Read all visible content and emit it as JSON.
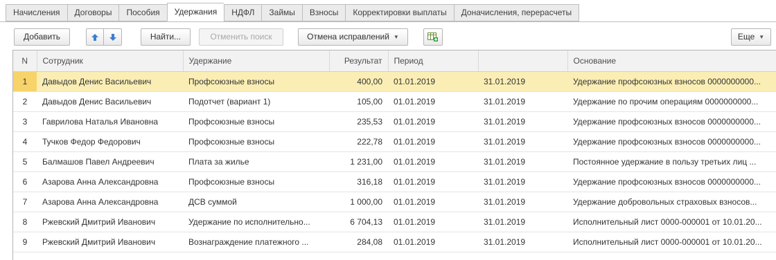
{
  "tabs": [
    {
      "label": "Начисления",
      "active": false
    },
    {
      "label": "Договоры",
      "active": false
    },
    {
      "label": "Пособия",
      "active": false
    },
    {
      "label": "Удержания",
      "active": true
    },
    {
      "label": "НДФЛ",
      "active": false
    },
    {
      "label": "Займы",
      "active": false
    },
    {
      "label": "Взносы",
      "active": false
    },
    {
      "label": "Корректировки выплаты",
      "active": false
    },
    {
      "label": "Доначисления, перерасчеты",
      "active": false
    }
  ],
  "toolbar": {
    "add_label": "Добавить",
    "find_label": "Найти...",
    "cancel_search_label": "Отменить поиск",
    "cancel_corrections_label": "Отмена исправлений",
    "more_label": "Еще",
    "up_icon": "arrow-up-icon",
    "down_icon": "arrow-down-icon",
    "grid_icon": "add-table-icon"
  },
  "colors": {
    "selected_row": "#fbeeb5",
    "selected_index": "#f7d36a",
    "arrow_blue": "#3a7fcf"
  },
  "table": {
    "columns": [
      "N",
      "Сотрудник",
      "Удержание",
      "Результат",
      "Период",
      "",
      "Основание"
    ],
    "rows": [
      [
        "1",
        "Давыдов Денис Васильевич",
        "Профсоюзные взносы",
        "400,00",
        "01.01.2019",
        "31.01.2019",
        "Удержание профсоюзных взносов 0000000000..."
      ],
      [
        "2",
        "Давыдов Денис Васильевич",
        "Подотчет (вариант 1)",
        "105,00",
        "01.01.2019",
        "31.01.2019",
        "Удержание по прочим операциям 0000000000..."
      ],
      [
        "3",
        "Гаврилова Наталья Ивановна",
        "Профсоюзные взносы",
        "235,53",
        "01.01.2019",
        "31.01.2019",
        "Удержание профсоюзных взносов 0000000000..."
      ],
      [
        "4",
        "Тучков Федор Федорович",
        "Профсоюзные взносы",
        "222,78",
        "01.01.2019",
        "31.01.2019",
        "Удержание профсоюзных взносов 0000000000..."
      ],
      [
        "5",
        "Балмашов Павел Андреевич",
        "Плата за жилье",
        "1 231,00",
        "01.01.2019",
        "31.01.2019",
        "Постоянное удержание в пользу третьих лиц ..."
      ],
      [
        "6",
        "Азарова Анна Александровна",
        "Профсоюзные взносы",
        "316,18",
        "01.01.2019",
        "31.01.2019",
        "Удержание профсоюзных взносов 0000000000..."
      ],
      [
        "7",
        "Азарова Анна Александровна",
        "ДСВ суммой",
        "1 000,00",
        "01.01.2019",
        "31.01.2019",
        "Удержание добровольных страховых взносов..."
      ],
      [
        "8",
        "Ржевский Дмитрий Иванович",
        "Удержание по исполнительно...",
        "6 704,13",
        "01.01.2019",
        "31.01.2019",
        "Исполнительный лист 0000-000001 от 10.01.20..."
      ],
      [
        "9",
        "Ржевский Дмитрий Иванович",
        "Вознаграждение платежного ...",
        "284,08",
        "01.01.2019",
        "31.01.2019",
        "Исполнительный лист 0000-000001 от 10.01.20..."
      ]
    ]
  }
}
